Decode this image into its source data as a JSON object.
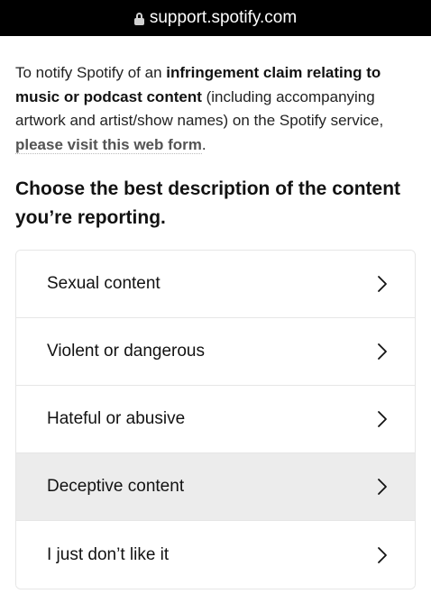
{
  "browser": {
    "url": "support.spotify.com"
  },
  "intro": {
    "text_1": "To notify Spotify of an ",
    "bold": "infringement claim relating to music or podcast content",
    "text_2": " (including accompanying artwork and artist/show names) on the Spotify service, ",
    "link": "please visit this web form",
    "text_3": "."
  },
  "heading": "Choose the best description of the content you’re reporting.",
  "options": [
    {
      "label": "Sexual content",
      "icon": "chevron-right-icon"
    },
    {
      "label": "Violent or dangerous",
      "icon": "chevron-right-icon"
    },
    {
      "label": "Hateful or abusive",
      "icon": "chevron-right-icon"
    },
    {
      "label": "Deceptive content",
      "icon": "chevron-right-icon",
      "highlighted": true
    },
    {
      "label": "I just don’t like it",
      "icon": "chevron-right-icon"
    }
  ]
}
